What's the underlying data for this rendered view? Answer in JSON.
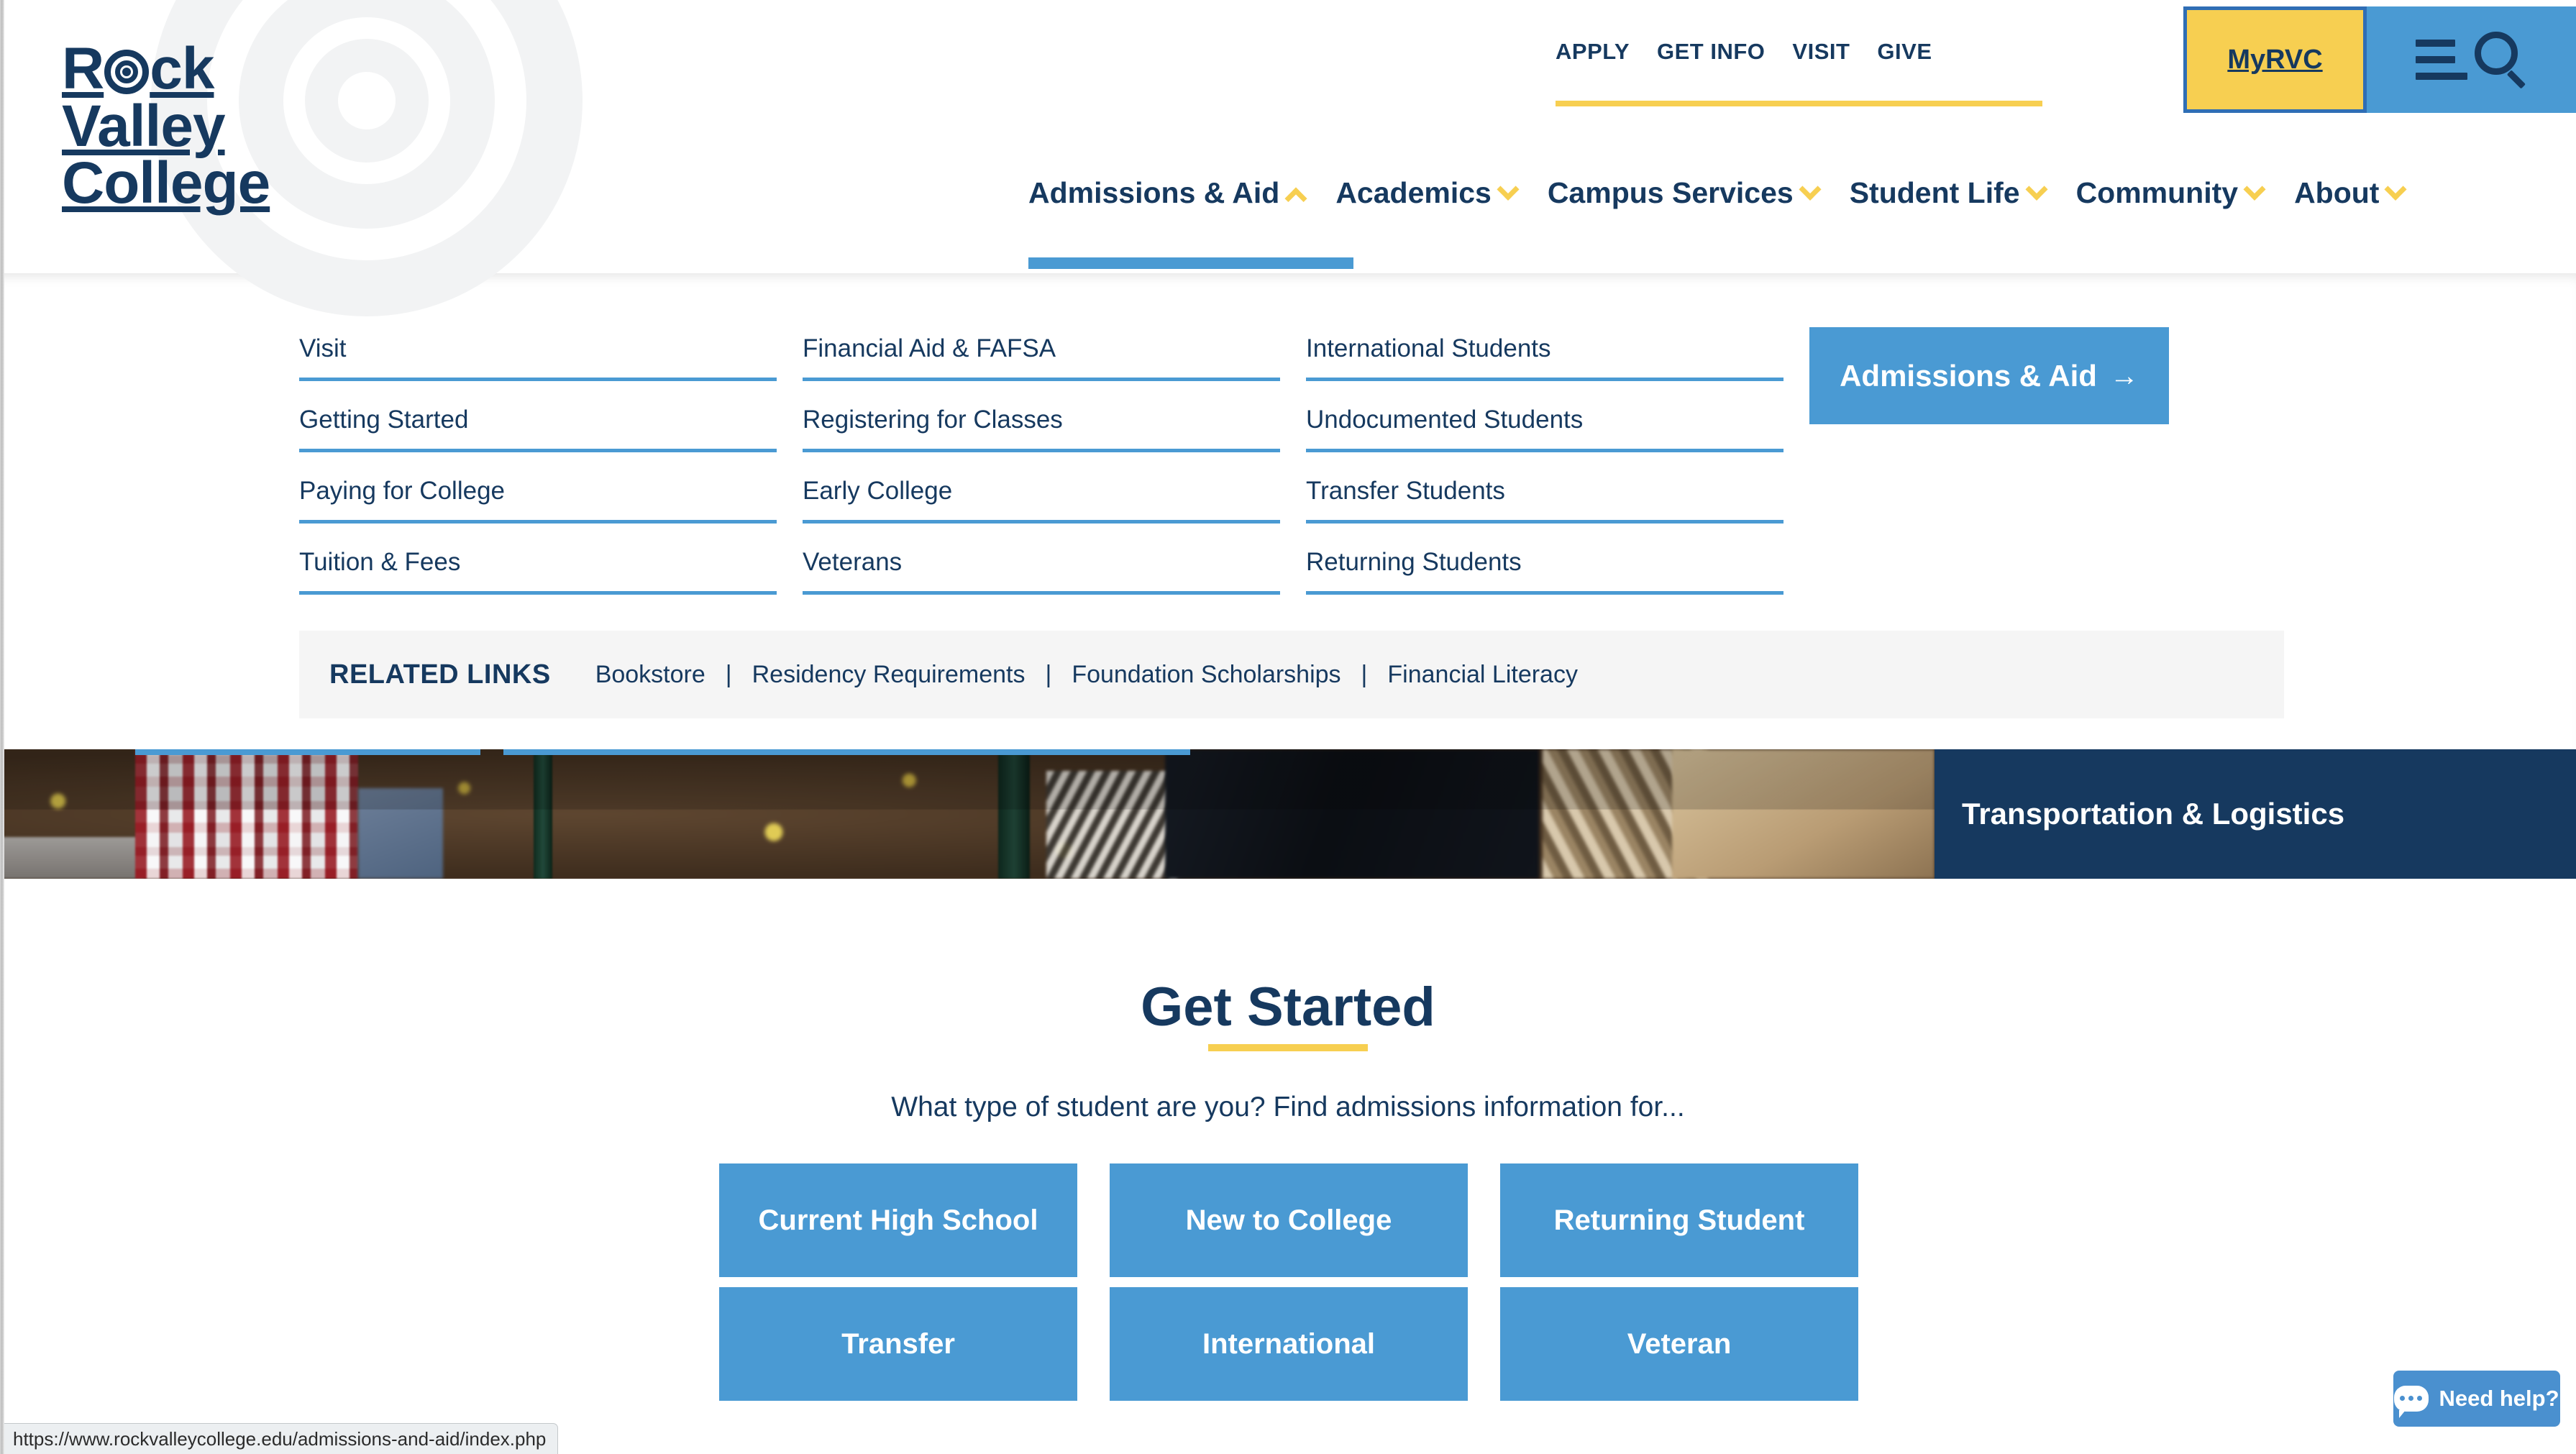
{
  "site": {
    "logo_lines": [
      "Rock",
      "Valley",
      "College"
    ],
    "logo_icon": "spiral-target-icon"
  },
  "utility_nav": {
    "items": [
      {
        "label": "APPLY"
      },
      {
        "label": "GET INFO"
      },
      {
        "label": "VISIT"
      },
      {
        "label": "GIVE"
      }
    ],
    "myrvc_label": "MyRVC",
    "menu_icon": "hamburger-icon",
    "search_icon": "search-icon"
  },
  "main_nav": {
    "items": [
      {
        "label": "Admissions & Aid",
        "state": "expanded",
        "chevron": "chevron-up-icon"
      },
      {
        "label": "Academics",
        "state": "collapsed",
        "chevron": "chevron-down-icon"
      },
      {
        "label": "Campus Services",
        "state": "collapsed",
        "chevron": "chevron-down-icon"
      },
      {
        "label": "Student Life",
        "state": "collapsed",
        "chevron": "chevron-down-icon"
      },
      {
        "label": "Community",
        "state": "collapsed",
        "chevron": "chevron-down-icon"
      },
      {
        "label": "About",
        "state": "collapsed",
        "chevron": "chevron-down-icon"
      }
    ]
  },
  "dropdown": {
    "columns": [
      {
        "links": [
          {
            "label": "Visit"
          },
          {
            "label": "Getting Started"
          },
          {
            "label": "Paying for College"
          },
          {
            "label": "Tuition & Fees"
          }
        ]
      },
      {
        "links": [
          {
            "label": "Financial Aid & FAFSA"
          },
          {
            "label": "Registering for Classes"
          },
          {
            "label": "Early College"
          },
          {
            "label": "Veterans"
          }
        ]
      },
      {
        "links": [
          {
            "label": "International Students"
          },
          {
            "label": "Undocumented Students"
          },
          {
            "label": "Transfer Students"
          },
          {
            "label": "Returning Students"
          }
        ]
      }
    ],
    "cta": {
      "label": "Admissions & Aid",
      "arrow": "→",
      "icon": "arrow-right-icon"
    },
    "related_links": {
      "title": "RELATED LINKS",
      "separator": "|",
      "items": [
        {
          "label": "Bookstore"
        },
        {
          "label": "Residency Requirements"
        },
        {
          "label": "Foundation Scholarships"
        },
        {
          "label": "Financial Literacy"
        }
      ]
    }
  },
  "banner": {
    "label": "Transportation & Logistics",
    "photo_alt": "students-outdoors-autumn-photo"
  },
  "get_started": {
    "title": "Get Started",
    "subtitle": "What type of student are you? Find admissions information for...",
    "buttons": [
      {
        "label": "Current High School"
      },
      {
        "label": "New to College"
      },
      {
        "label": "Returning Student"
      },
      {
        "label": "Transfer"
      },
      {
        "label": "International"
      },
      {
        "label": "Veteran"
      }
    ]
  },
  "chat_widget": {
    "label": "Need help?",
    "icon": "chat-bubble-icon"
  },
  "status_bar": {
    "url": "https://www.rockvalleycollege.edu/admissions-and-aid/index.php"
  },
  "colors": {
    "navy": "#16395f",
    "blue": "#4a9ad3",
    "yellow": "#f7cf51",
    "light_gray": "#f5f5f5",
    "white": "#ffffff"
  }
}
